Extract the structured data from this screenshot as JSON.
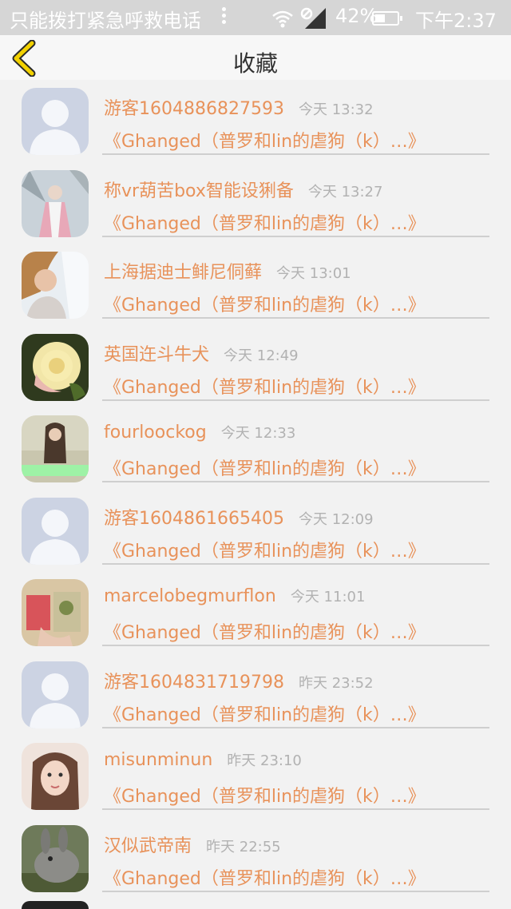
{
  "status_bar": {
    "carrier_text": "只能拨打紧急呼救电话",
    "battery": "42%",
    "time": "下午2:37",
    "icons": [
      "wifi-icon",
      "no-sim-icon",
      "signal-icon",
      "battery-icon"
    ]
  },
  "header": {
    "back_icon": "chevron-left-icon",
    "title": "收藏"
  },
  "items": [
    {
      "name": "游客1604886827593",
      "time": "今天 13:32",
      "title": "《Ghanged（普罗和lin的虐狗（k）…》",
      "avatar": "default"
    },
    {
      "name": "称vr葫苦box智能设猁备",
      "time": "今天 13:27",
      "title": "《Ghanged（普罗和lin的虐狗（k）…》",
      "avatar": "photo"
    },
    {
      "name": "上海据迪士鲱尼侗藓",
      "time": "今天 13:01",
      "title": "《Ghanged（普罗和lin的虐狗（k）…》",
      "avatar": "photo"
    },
    {
      "name": "英国迕斗牛犬",
      "time": "今天 12:49",
      "title": "《Ghanged（普罗和lin的虐狗（k）…》",
      "avatar": "photo"
    },
    {
      "name": "fourloockog",
      "time": "今天 12:33",
      "title": "《Ghanged（普罗和lin的虐狗（k）…》",
      "avatar": "photo"
    },
    {
      "name": "游客1604861665405",
      "time": "今天 12:09",
      "title": "《Ghanged（普罗和lin的虐狗（k）…》",
      "avatar": "default"
    },
    {
      "name": "marcelobegmurflon",
      "time": "今天 11:01",
      "title": "《Ghanged（普罗和lin的虐狗（k）…》",
      "avatar": "photo"
    },
    {
      "name": "游客1604831719798",
      "time": "昨天 23:52",
      "title": "《Ghanged（普罗和lin的虐狗（k）…》",
      "avatar": "default"
    },
    {
      "name": "misunminun",
      "time": "昨天 23:10",
      "title": "《Ghanged（普罗和lin的虐狗（k）…》",
      "avatar": "photo"
    },
    {
      "name": "汉似武帝南",
      "time": "昨天 22:55",
      "title": "《Ghanged（普罗和lin的虐狗（k）…》",
      "avatar": "photo"
    }
  ],
  "colors": {
    "accent": "#e8925a",
    "back_icon": "#f2d100",
    "time_text": "#b2b2b2",
    "default_avatar_bg": "#ccd3e3"
  }
}
